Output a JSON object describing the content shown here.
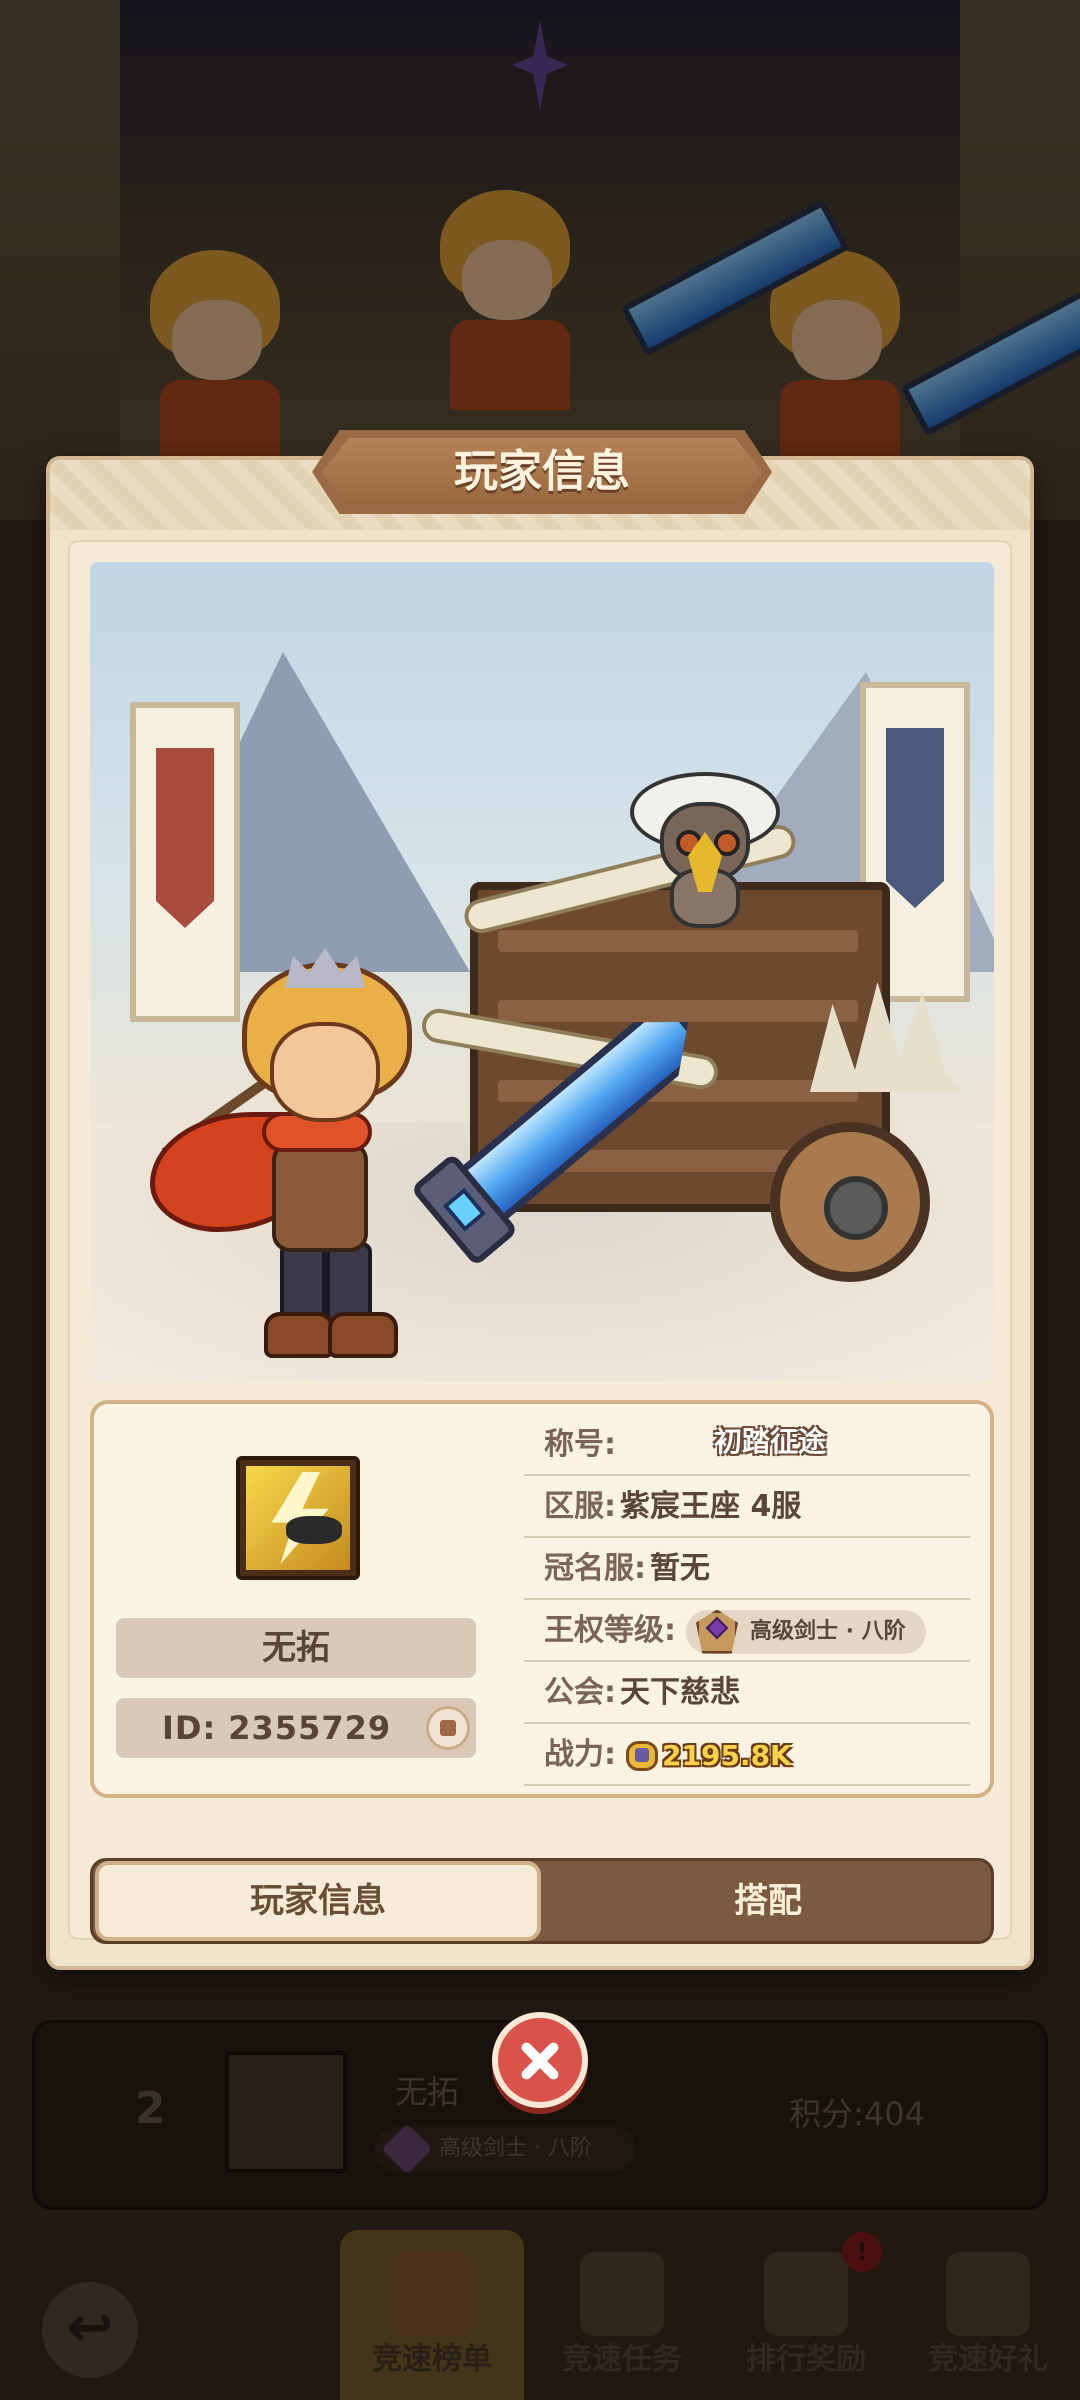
{
  "dialog": {
    "title": "玩家信息",
    "player": {
      "name": "无拓",
      "id_label": "ID:",
      "id_value": "2355729",
      "title_label": "称号:",
      "title_value": "初踏征途",
      "server_label": "区服:",
      "server_value": "紫宸王座 4服",
      "named_server_label": "冠名服:",
      "named_server_value": "暂无",
      "rank_label": "王权等级:",
      "rank_value": "高级剑士 · 八阶",
      "guild_label": "公会:",
      "guild_value": "天下慈悲",
      "power_label": "战力:",
      "power_value": "2195.8K"
    },
    "tabs": [
      "玩家信息",
      "搭配"
    ],
    "active_tab": 0
  },
  "background": {
    "leaderboard_row": {
      "rank": "2",
      "name": "无拓",
      "rank_badge": "高级剑士 · 八阶",
      "score": "积分:404"
    },
    "bottom_nav": [
      {
        "label": "竞速榜单",
        "active": true
      },
      {
        "label": "竞速任务",
        "active": false
      },
      {
        "label": "排行奖励",
        "active": false,
        "badge": "!"
      },
      {
        "label": "竞速好礼",
        "active": false
      }
    ]
  },
  "icons": {
    "close": "close-icon",
    "back": "back-arrow-icon",
    "copy": "copy-icon",
    "rank_emblem": "rank-emblem-icon",
    "power": "power-icon"
  },
  "colors": {
    "dialog_bg": "#efe3cc",
    "title_ribbon": "#9a6a45",
    "tab_inactive_bg": "#7a5a40",
    "close_button": "#d9534a",
    "power_text": "#f8d24a"
  }
}
